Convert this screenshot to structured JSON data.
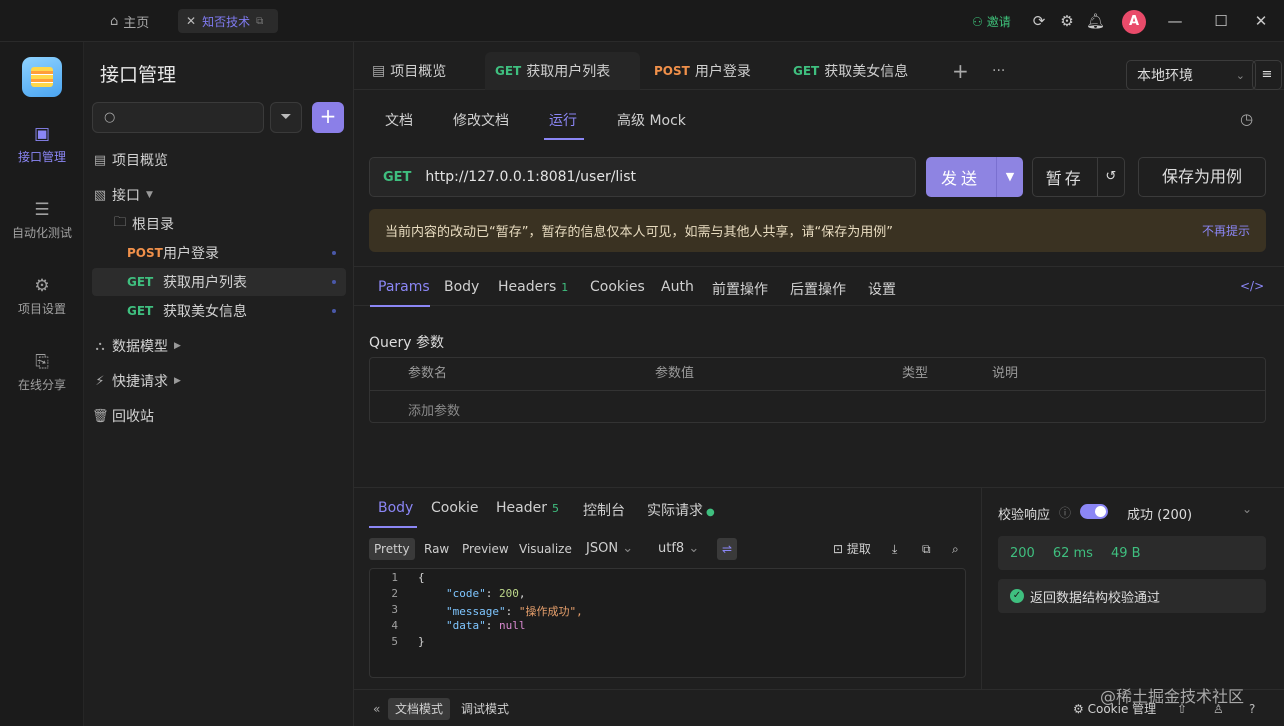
{
  "titlebar": {
    "home_label": "主页",
    "tab_label": "知否技术",
    "invite_label": "邀请",
    "avatar_letter": "A"
  },
  "rail": {
    "items": [
      {
        "label": "接口管理"
      },
      {
        "label": "自动化测试"
      },
      {
        "label": "项目设置"
      },
      {
        "label": "在线分享"
      }
    ]
  },
  "sidebar": {
    "title": "接口管理",
    "items": [
      {
        "label": "项目概览"
      },
      {
        "label": "接口"
      },
      {
        "label": "根目录"
      },
      {
        "method": "POST",
        "label": "用户登录"
      },
      {
        "method": "GET",
        "label": "获取用户列表"
      },
      {
        "method": "GET",
        "label": "获取美女信息"
      },
      {
        "label": "数据模型"
      },
      {
        "label": "快捷请求"
      },
      {
        "label": "回收站"
      }
    ]
  },
  "doc_tabs": [
    {
      "label": "项目概览"
    },
    {
      "method": "GET",
      "label": "获取用户列表"
    },
    {
      "method": "POST",
      "label": "用户登录"
    },
    {
      "method": "GET",
      "label": "获取美女信息"
    }
  ],
  "env": {
    "label": "本地环境"
  },
  "sub_tabs": [
    "文档",
    "修改文档",
    "运行",
    "高级 Mock"
  ],
  "request": {
    "method": "GET",
    "url": "http://127.0.0.1:8081/user/list",
    "send_label": "发送",
    "save_label": "暂存",
    "save_case_label": "保存为用例"
  },
  "notice": {
    "text": "当前内容的改动已“暂存”，暂存的信息仅本人可见，如需与其他人共享，请“保存为用例”",
    "dismiss": "不再提示"
  },
  "param_tabs": [
    {
      "label": "Params"
    },
    {
      "label": "Body"
    },
    {
      "label": "Headers",
      "count": "1"
    },
    {
      "label": "Cookies"
    },
    {
      "label": "Auth"
    },
    {
      "label": "前置操作"
    },
    {
      "label": "后置操作"
    },
    {
      "label": "设置"
    }
  ],
  "query": {
    "title": "Query 参数",
    "headers": [
      "参数名",
      "参数值",
      "类型",
      "说明"
    ],
    "add_label": "添加参数"
  },
  "response": {
    "tabs": [
      {
        "label": "Body"
      },
      {
        "label": "Cookie"
      },
      {
        "label": "Header",
        "count": "5"
      },
      {
        "label": "控制台"
      },
      {
        "label": "实际请求"
      }
    ],
    "formats": [
      "Pretty",
      "Raw",
      "Preview",
      "Visualize"
    ],
    "type": "JSON",
    "encoding": "utf8",
    "extract_label": "提取",
    "code_lines": [
      {
        "no": "1",
        "text": "{"
      },
      {
        "no": "2",
        "key": "\"code\"",
        "value": "200"
      },
      {
        "no": "3",
        "key": "\"message\"",
        "value": "\"操作成功\","
      },
      {
        "no": "4",
        "key": "\"data\"",
        "value": "null"
      },
      {
        "no": "5",
        "text": "}"
      }
    ]
  },
  "validation": {
    "label": "校验响应",
    "result": "成功 (200)",
    "status": "200",
    "time": "62 ms",
    "size": "49 B",
    "message": "返回数据结构校验通过"
  },
  "bottom": {
    "doc_mode": "文档模式",
    "debug_mode": "调试模式",
    "cookie_label": "Cookie 管理"
  },
  "watermark": "@稀土掘金技术社区"
}
